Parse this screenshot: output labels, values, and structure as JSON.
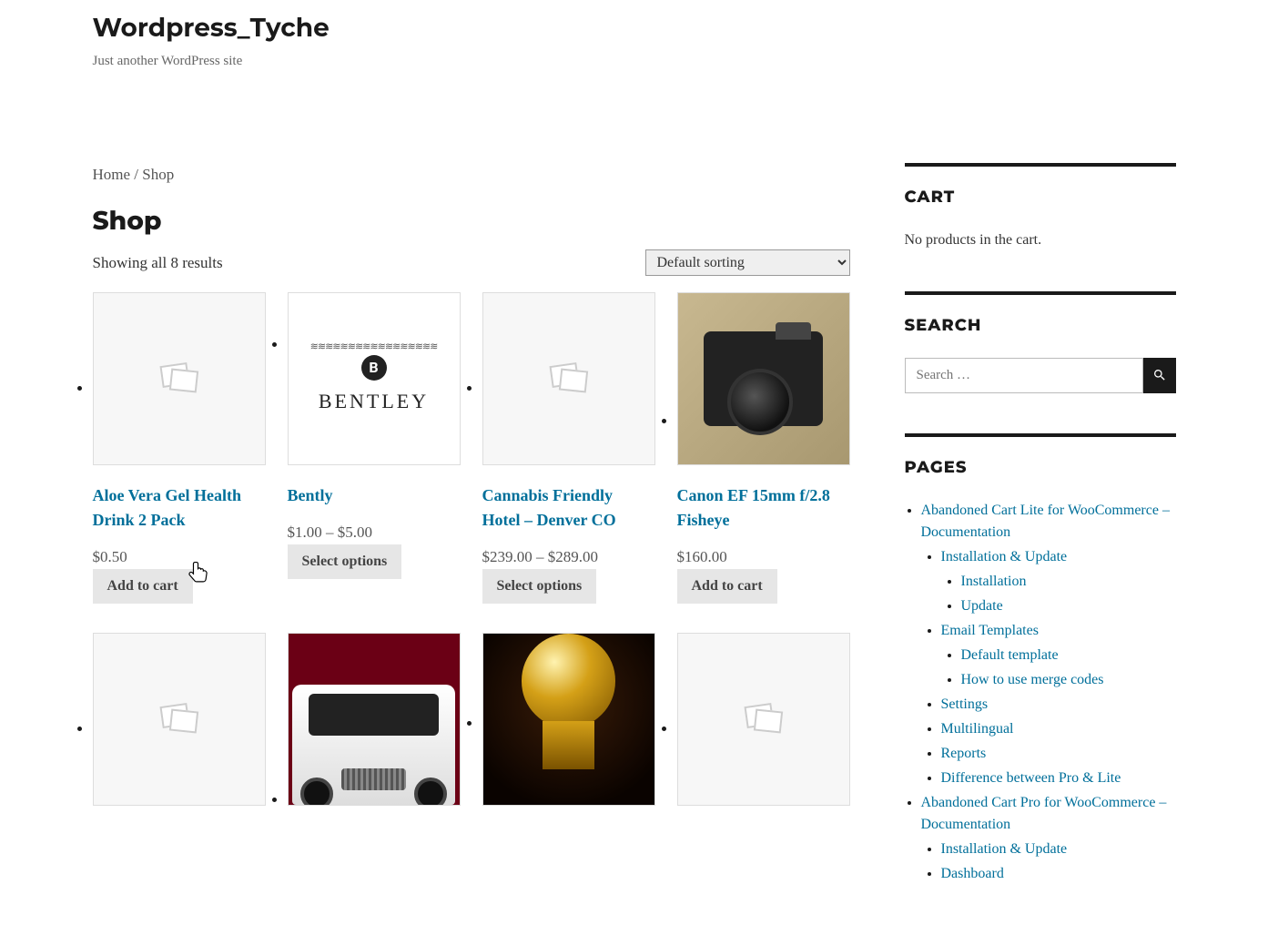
{
  "site": {
    "title": "Wordpress_Tyche",
    "tagline": "Just another WordPress site"
  },
  "breadcrumb": {
    "home": "Home",
    "sep": " / ",
    "current": "Shop"
  },
  "shop": {
    "title": "Shop",
    "result_count": "Showing all 8 results",
    "sort_selected": "Default sorting"
  },
  "products": [
    {
      "title": "Aloe Vera Gel Health Drink 2 Pack",
      "price": "$0.50",
      "button": "Add to cart",
      "image": "placeholder"
    },
    {
      "title": "Bently",
      "price": "$1.00 – $5.00",
      "button": "Select options",
      "image": "bentley"
    },
    {
      "title": "Cannabis Friendly Hotel – Denver CO",
      "price": "$239.00 – $289.00",
      "button": "Select options",
      "image": "placeholder"
    },
    {
      "title": "Canon EF 15mm f/2.8 Fisheye",
      "price": "$160.00",
      "button": "Add to cart",
      "image": "camera"
    },
    {
      "title": "",
      "price": "",
      "button": "",
      "image": "placeholder"
    },
    {
      "title": "",
      "price": "",
      "button": "",
      "image": "suv"
    },
    {
      "title": "",
      "price": "",
      "button": "",
      "image": "globe"
    },
    {
      "title": "",
      "price": "",
      "button": "",
      "image": "placeholder"
    }
  ],
  "sidebar": {
    "cart": {
      "title": "CART",
      "empty": "No products in the cart."
    },
    "search": {
      "title": "SEARCH",
      "placeholder": "Search …"
    },
    "pages": {
      "title": "PAGES",
      "items": [
        "Abandoned Cart Lite for WooCommerce – Documentation",
        "Installation & Update",
        "Installation",
        "Update",
        "Email Templates",
        "Default template",
        "How to use merge codes",
        "Settings",
        "Multilingual",
        "Reports",
        "Difference between Pro & Lite",
        "Abandoned Cart Pro for WooCommerce – Documentation",
        "Installation & Update",
        "Dashboard"
      ]
    }
  }
}
